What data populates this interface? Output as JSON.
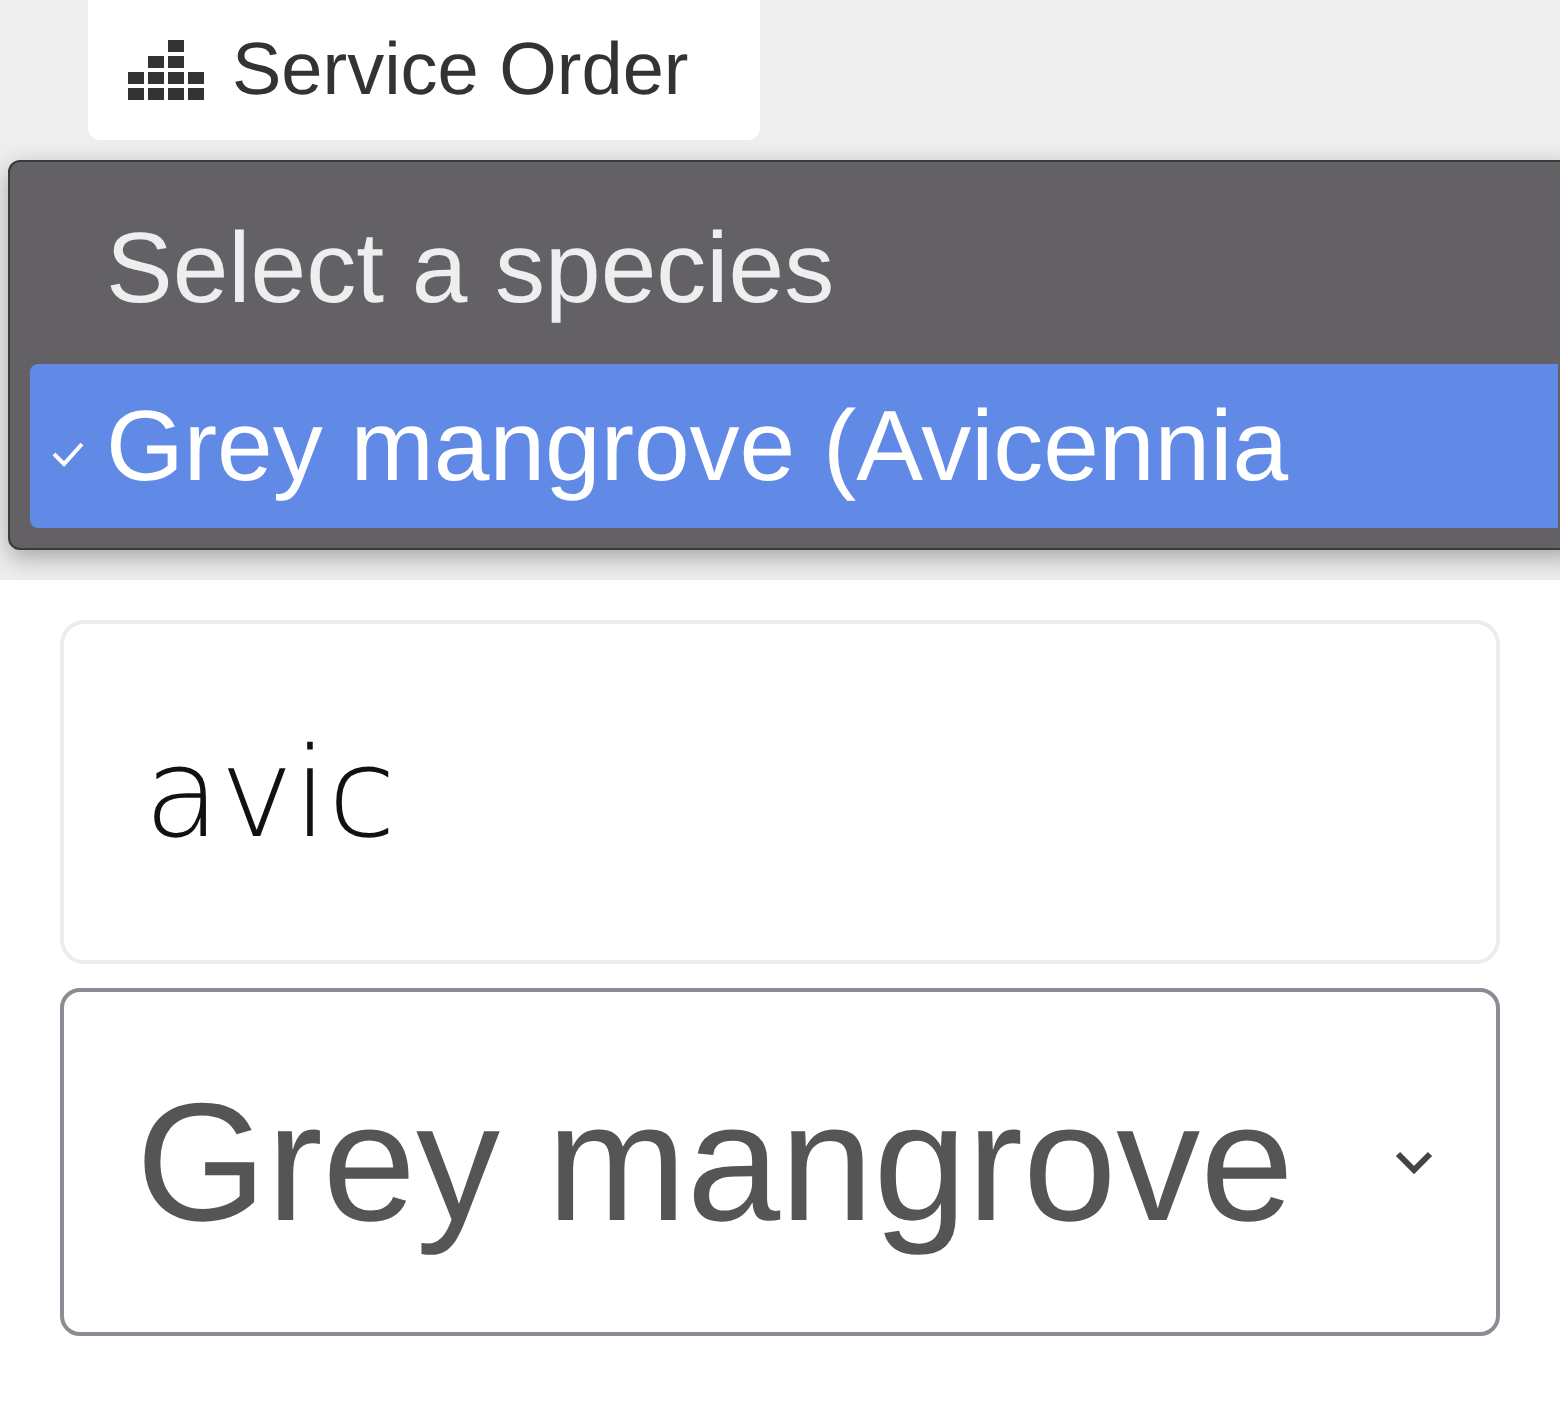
{
  "tab": {
    "label": "Service Order"
  },
  "menu": {
    "options": [
      {
        "label": "Select a species",
        "selected": false
      },
      {
        "label": "Grey mangrove (Avicennia",
        "selected": true
      }
    ]
  },
  "search": {
    "value": "avic"
  },
  "species_select": {
    "value": "Grey mangrove"
  }
}
